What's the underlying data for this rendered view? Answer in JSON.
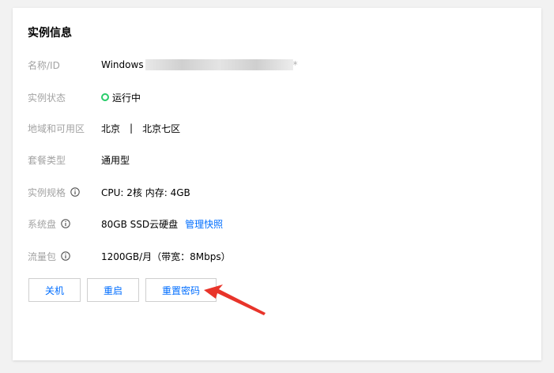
{
  "card": {
    "title": "实例信息"
  },
  "rows": {
    "name": {
      "label": "名称/ID",
      "value_prefix": "Windows",
      "value_suffix": "*"
    },
    "status": {
      "label": "实例状态",
      "value": "运行中",
      "status_color": "#29cc6a"
    },
    "region": {
      "label": "地域和可用区",
      "region": "北京",
      "separator": "|",
      "zone": "北京七区"
    },
    "package": {
      "label": "套餐类型",
      "value": "通用型"
    },
    "spec": {
      "label": "实例规格",
      "value": "CPU: 2核 内存: 4GB"
    },
    "disk": {
      "label": "系统盘",
      "value": "80GB SSD云硬盘",
      "link": "管理快照"
    },
    "traffic": {
      "label": "流量包",
      "value": "1200GB/月（带宽：8Mbps）"
    }
  },
  "buttons": {
    "shutdown": "关机",
    "restart": "重启",
    "reset_password": "重置密码"
  },
  "colors": {
    "accent": "#006eff",
    "label": "#a3a3a3",
    "annotation_arrow": "#e8342a"
  }
}
